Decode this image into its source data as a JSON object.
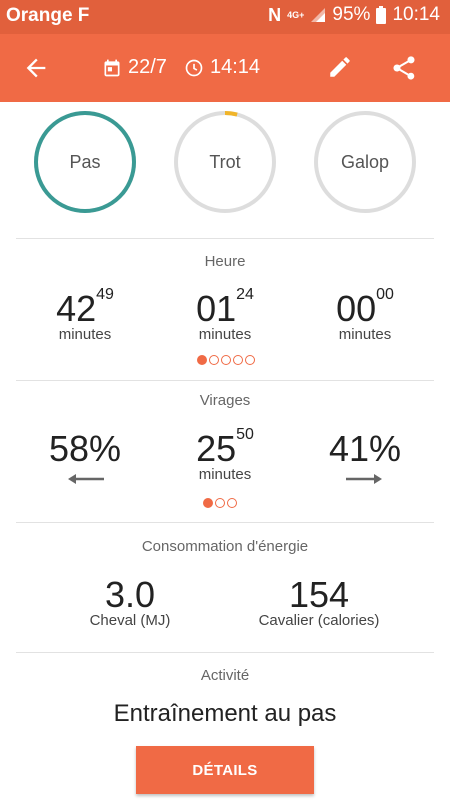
{
  "status_bar": {
    "carrier": "Orange F",
    "nfc": "N",
    "network": "4G+",
    "battery": "95%",
    "time": "10:14"
  },
  "app_bar": {
    "date": "22/7",
    "time": "14:14"
  },
  "gaits": [
    {
      "label": "Pas",
      "progress": 1.0,
      "color": "#3a9a94"
    },
    {
      "label": "Trot",
      "progress": 0.04,
      "color": "#f0b429"
    },
    {
      "label": "Galop",
      "progress": 0.0,
      "color": "#dddddd"
    }
  ],
  "time_section": {
    "title": "Heure",
    "values": [
      {
        "main": "42",
        "sup": "49",
        "unit": "minutes"
      },
      {
        "main": "01",
        "sup": "24",
        "unit": "minutes"
      },
      {
        "main": "00",
        "sup": "00",
        "unit": "minutes"
      }
    ],
    "pager": {
      "count": 5,
      "active": 0
    }
  },
  "turns_section": {
    "title": "Virages",
    "left": "58%",
    "center": {
      "main": "25",
      "sup": "50",
      "unit": "minutes"
    },
    "right": "41%",
    "pager": {
      "count": 3,
      "active": 0
    }
  },
  "energy_section": {
    "title": "Consommation d'énergie",
    "horse": {
      "value": "3.0",
      "label": "Cheval (MJ)"
    },
    "rider": {
      "value": "154",
      "label": "Cavalier (calories)"
    }
  },
  "activity_section": {
    "title": "Activité",
    "value": "Entraînement au pas"
  },
  "details_button": "DÉTAILS",
  "colors": {
    "accent": "#f06a45",
    "status_bar": "#e1603c"
  },
  "icons": [
    "back-arrow-icon",
    "calendar-icon",
    "clock-icon",
    "edit-pencil-icon",
    "share-icon",
    "left-arrow-icon",
    "right-arrow-icon",
    "signal-icon",
    "battery-icon"
  ]
}
